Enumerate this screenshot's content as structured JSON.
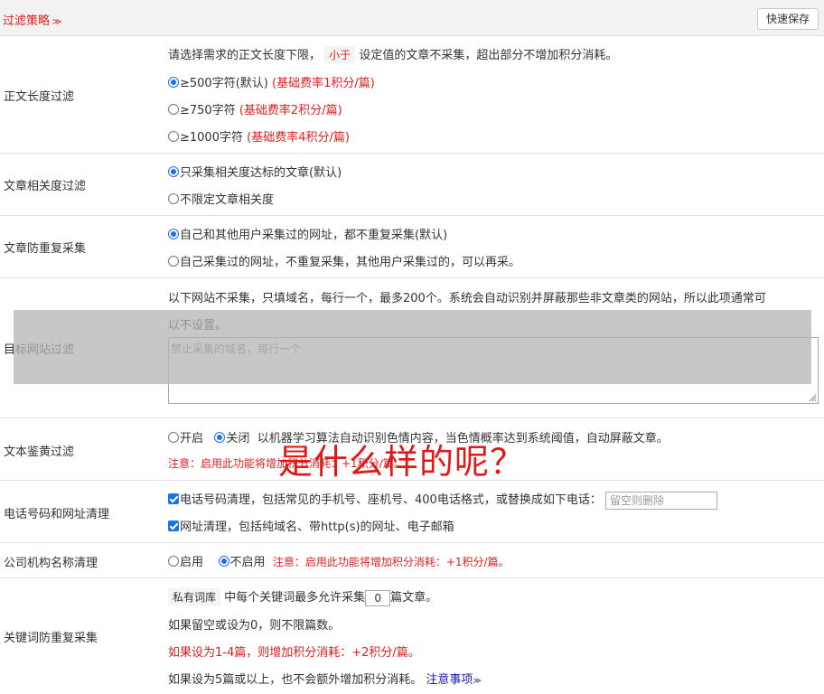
{
  "header": {
    "title": "过滤策略",
    "save_label": "快速保存"
  },
  "length_filter": {
    "label": "正文长度过滤",
    "desc_pre": "请选择需求的正文长度下限，",
    "desc_tag": "小于",
    "desc_post": "设定值的文章不采集，超出部分不增加积分消耗。",
    "options": [
      {
        "text": "≥500字符(默认)",
        "note": "(基础费率1积分/篇)",
        "selected": true
      },
      {
        "text": "≥750字符",
        "note": "(基础费率2积分/篇)",
        "selected": false
      },
      {
        "text": "≥1000字符",
        "note": "(基础费率4积分/篇)",
        "selected": false
      }
    ]
  },
  "relevance_filter": {
    "label": "文章相关度过滤",
    "options": [
      {
        "text": "只采集相关度达标的文章(默认)",
        "selected": true
      },
      {
        "text": "不限定文章相关度",
        "selected": false
      }
    ]
  },
  "duplicate_filter": {
    "label": "文章防重复采集",
    "options": [
      {
        "text": "自己和其他用户采集过的网址，都不重复采集(默认)",
        "selected": true
      },
      {
        "text": "自己采集过的网址，不重复采集，其他用户采集过的，可以再采。",
        "selected": false
      }
    ]
  },
  "site_filter": {
    "label": "目标网站过滤",
    "desc_line1": "以下网站不采集，只填域名，每行一个，最多200个。系统会自动识别并屏蔽那些非文章类的网站，所以此项通常可",
    "desc_line2": "以不设置。",
    "placeholder": "禁止采集的域名，每行一个"
  },
  "porn_filter": {
    "label": "文本鉴黄过滤",
    "on_label": "开启",
    "off_label": "关闭",
    "desc": "以机器学习算法自动识别色情内容，当色情概率达到系统阈值，自动屏蔽文章。",
    "warning": "注意：启用此功能将增加积分消耗：+1积分/篇。"
  },
  "phone_filter": {
    "label": "电话号码和网址清理",
    "phone_text": "电话号码清理，包括常见的手机号、座机号、400电话格式，或替换成如下电话：",
    "phone_placeholder": "留空则删除",
    "url_text": "网址清理，包括纯域名、带http(s)的网址、电子邮箱"
  },
  "company_filter": {
    "label": "公司机构名称清理",
    "on_label": "启用",
    "off_label": "不启用",
    "warning": "注意：启用此功能将增加积分消耗：+1积分/篇。"
  },
  "keyword_filter": {
    "label": "关键词防重复采集",
    "tag": "私有词库",
    "line1_pre": "中每个关键词最多允许采集",
    "count_value": "0",
    "line1_post": "篇文章。",
    "line2": "如果留空或设为0，则不限篇数。",
    "line3": "如果设为1-4篇，则增加积分消耗：+2积分/篇。",
    "line4": "如果设为5篇或以上，也不会额外增加积分消耗。",
    "note_link": "注意事项"
  },
  "annotation": {
    "text": "是什么样的呢？",
    "color": "#e01818"
  }
}
